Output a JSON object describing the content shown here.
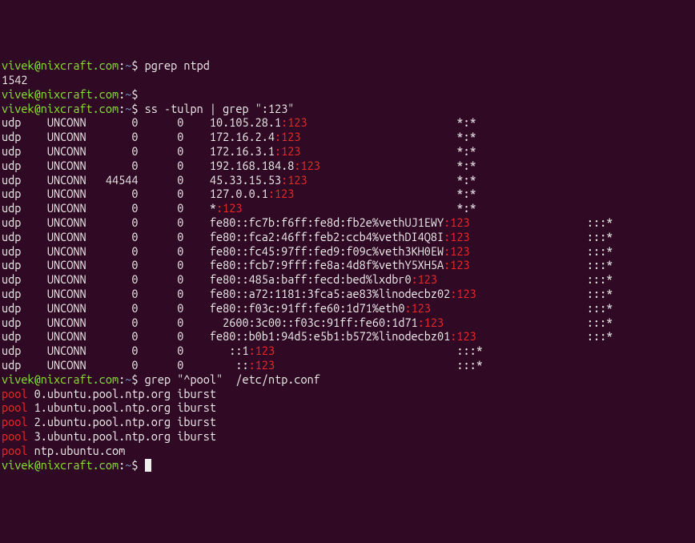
{
  "prompt_user": "vivek@nixcraft.com",
  "prompt_sep": ":",
  "prompt_path": "~",
  "prompt_end": "$ ",
  "cmd_pgrep": "pgrep ntpd",
  "pgrep_out": "1542",
  "cmd_ss": "ss -tulpn | grep \":123\"",
  "cmd_grep": "grep \"^pool\"  /etc/ntp.conf",
  "ss_rows": [
    {
      "proto": "udp",
      "state": "UNCONN",
      "recvq": "0",
      "sendq": "0",
      "local": "10.105.28.1",
      "port": ":123",
      "peer": "*:*"
    },
    {
      "proto": "udp",
      "state": "UNCONN",
      "recvq": "0",
      "sendq": "0",
      "local": "172.16.2.4",
      "port": ":123",
      "peer": "*:*"
    },
    {
      "proto": "udp",
      "state": "UNCONN",
      "recvq": "0",
      "sendq": "0",
      "local": "172.16.3.1",
      "port": ":123",
      "peer": "*:*"
    },
    {
      "proto": "udp",
      "state": "UNCONN",
      "recvq": "0",
      "sendq": "0",
      "local": "192.168.184.8",
      "port": ":123",
      "peer": "*:*"
    },
    {
      "proto": "udp",
      "state": "UNCONN",
      "recvq": "44544",
      "sendq": "0",
      "local": "45.33.15.53",
      "port": ":123",
      "peer": "*:*"
    },
    {
      "proto": "udp",
      "state": "UNCONN",
      "recvq": "0",
      "sendq": "0",
      "local": "127.0.0.1",
      "port": ":123",
      "peer": "*:*"
    },
    {
      "proto": "udp",
      "state": "UNCONN",
      "recvq": "0",
      "sendq": "0",
      "local": "*",
      "port": ":123",
      "peer": "*:*"
    },
    {
      "proto": "udp",
      "state": "UNCONN",
      "recvq": "0",
      "sendq": "0",
      "local": "fe80::fc7b:f6ff:fe8d:fb2e%vethUJ1EWY",
      "port": ":123",
      "peer": ":::*"
    },
    {
      "proto": "udp",
      "state": "UNCONN",
      "recvq": "0",
      "sendq": "0",
      "local": "fe80::fca2:46ff:feb2:ccb4%vethDI4Q8I",
      "port": ":123",
      "peer": ":::*"
    },
    {
      "proto": "udp",
      "state": "UNCONN",
      "recvq": "0",
      "sendq": "0",
      "local": "fe80::fc45:97ff:fed9:f09c%veth3KH0EW",
      "port": ":123",
      "peer": ":::*"
    },
    {
      "proto": "udp",
      "state": "UNCONN",
      "recvq": "0",
      "sendq": "0",
      "local": "fe80::fcb7:9fff:fe8a:4d8f%vethY5XH5A",
      "port": ":123",
      "peer": ":::*"
    },
    {
      "proto": "udp",
      "state": "UNCONN",
      "recvq": "0",
      "sendq": "0",
      "local": "fe80::485a:baff:fecd:bed%lxdbr0",
      "port": ":123",
      "peer": ":::*"
    },
    {
      "proto": "udp",
      "state": "UNCONN",
      "recvq": "0",
      "sendq": "0",
      "local": "fe80::a72:1181:3fca5:ae83%linodecbz02",
      "port": ":123",
      "peer": ":::*"
    },
    {
      "proto": "udp",
      "state": "UNCONN",
      "recvq": "0",
      "sendq": "0",
      "local": "fe80::f03c:91ff:fe60:1d71%eth0",
      "port": ":123",
      "peer": ":::*"
    },
    {
      "proto": "udp",
      "state": "UNCONN",
      "recvq": "0",
      "sendq": "0",
      "local": "  2600:3c00::f03c:91ff:fe60:1d71",
      "port": ":123",
      "peer": ":::*"
    },
    {
      "proto": "udp",
      "state": "UNCONN",
      "recvq": "0",
      "sendq": "0",
      "local": "fe80::b0b1:94d5:e5b1:b572%linodecbz01",
      "port": ":123",
      "peer": ":::*"
    },
    {
      "proto": "udp",
      "state": "UNCONN",
      "recvq": "0",
      "sendq": "0",
      "local": "   ::1",
      "port": ":123",
      "peer": ":::*"
    },
    {
      "proto": "udp",
      "state": "UNCONN",
      "recvq": "0",
      "sendq": "0",
      "local": "    ::",
      "port": ":123",
      "peer": ":::*"
    }
  ],
  "pool_lines": [
    {
      "kw": "pool",
      "rest": " 0.ubuntu.pool.ntp.org iburst"
    },
    {
      "kw": "pool",
      "rest": " 1.ubuntu.pool.ntp.org iburst"
    },
    {
      "kw": "pool",
      "rest": " 2.ubuntu.pool.ntp.org iburst"
    },
    {
      "kw": "pool",
      "rest": " 3.ubuntu.pool.ntp.org iburst"
    },
    {
      "kw": "pool",
      "rest": " ntp.ubuntu.com"
    }
  ]
}
